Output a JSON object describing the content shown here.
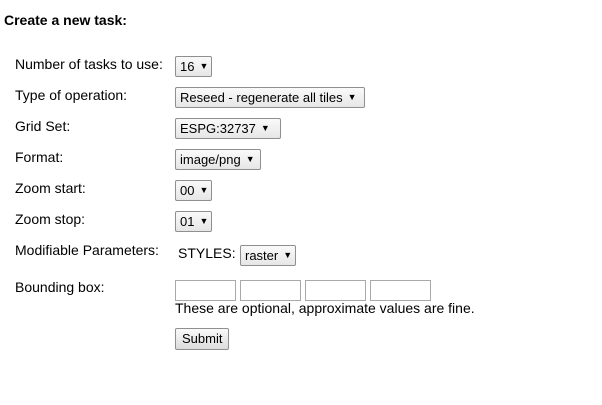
{
  "heading": "Create a new task:",
  "fields": {
    "threads": {
      "label": "Number of tasks to use:",
      "value": "16"
    },
    "operation": {
      "label": "Type of operation:",
      "value": "Reseed - regenerate all tiles"
    },
    "gridset": {
      "label": "Grid Set:",
      "value": "ESPG:32737"
    },
    "format": {
      "label": "Format:",
      "value": "image/png"
    },
    "zoom_start": {
      "label": "Zoom start:",
      "value": "00"
    },
    "zoom_stop": {
      "label": "Zoom stop:",
      "value": "01"
    },
    "params": {
      "label": "Modifiable Parameters:",
      "param_name": "STYLES:",
      "value": "raster"
    },
    "bbox": {
      "label": "Bounding box:",
      "note": "These are optional, approximate values are fine."
    }
  },
  "submit_label": "Submit"
}
